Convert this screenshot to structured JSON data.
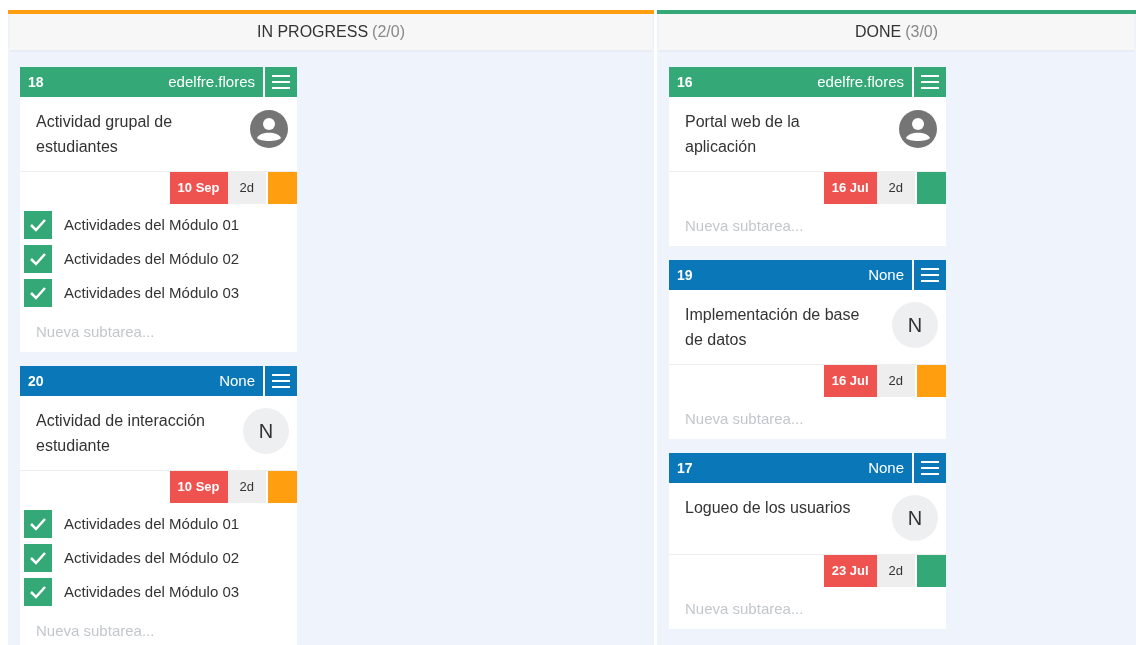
{
  "columns": [
    {
      "title": "IN PROGRESS",
      "count": "(2/0)",
      "color": "#ff9f0f",
      "cards": [
        {
          "id": "18",
          "assignee": "edelfre.flores",
          "header": {
            "color": "#35a877"
          },
          "avatar": {
            "kind": "user"
          },
          "title": "Actividad grupal de estudiantes",
          "date": "10 Sep",
          "duration": "2d",
          "priority": {
            "color": "#ff9f0f"
          },
          "subtasks": [
            {
              "label": "Actividades del Módulo 01",
              "checked": true
            },
            {
              "label": "Actividades del Módulo 02",
              "checked": true
            },
            {
              "label": "Actividades del Módulo 03",
              "checked": true
            }
          ],
          "placeholder": "Nueva subtarea..."
        },
        {
          "id": "20",
          "assignee": "None",
          "header": {
            "color": "#0a78b8"
          },
          "avatar": {
            "kind": "initial",
            "text": "N"
          },
          "title": "Actividad de interacción estudiante",
          "date": "10 Sep",
          "duration": "2d",
          "priority": {
            "color": "#ff9f0f"
          },
          "subtasks": [
            {
              "label": "Actividades del Módulo 01",
              "checked": true
            },
            {
              "label": "Actividades del Módulo 02",
              "checked": true
            },
            {
              "label": "Actividades del Módulo 03",
              "checked": true
            }
          ],
          "placeholder": "Nueva subtarea..."
        }
      ]
    },
    {
      "title": "DONE",
      "count": "(3/0)",
      "color": "#35a877",
      "cards": [
        {
          "id": "16",
          "assignee": "edelfre.flores",
          "header": {
            "color": "#35a877"
          },
          "avatar": {
            "kind": "user"
          },
          "title": "Portal web de la aplicación",
          "date": "16 Jul",
          "duration": "2d",
          "priority": {
            "color": "#35a877"
          },
          "placeholder": "Nueva subtarea..."
        },
        {
          "id": "19",
          "assignee": "None",
          "header": {
            "color": "#0a78b8"
          },
          "avatar": {
            "kind": "initial",
            "text": "N"
          },
          "title": "Implementación de base de datos",
          "date": "16 Jul",
          "duration": "2d",
          "priority": {
            "color": "#ff9f0f"
          },
          "placeholder": "Nueva subtarea..."
        },
        {
          "id": "17",
          "assignee": "None",
          "header": {
            "color": "#0a78b8"
          },
          "avatar": {
            "kind": "initial",
            "text": "N"
          },
          "title": "Logueo de los usuarios",
          "date": "23 Jul",
          "duration": "2d",
          "priority": {
            "color": "#35a877"
          },
          "placeholder": "Nueva subtarea..."
        }
      ]
    }
  ]
}
